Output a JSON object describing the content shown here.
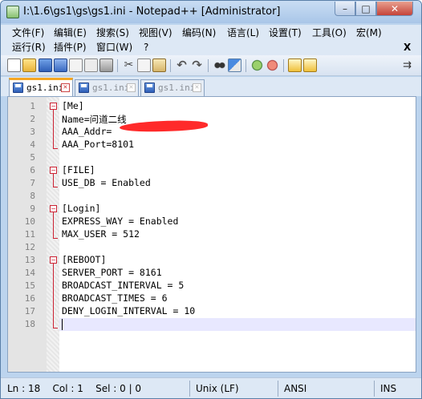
{
  "window": {
    "title": "I:\\1.6\\gs1\\gs\\gs1.ini - Notepad++ [Administrator]",
    "minimize_glyph": "–",
    "maximize_glyph": "□",
    "close_glyph": "✕"
  },
  "menubar": {
    "row1": [
      "文件(F)",
      "编辑(E)",
      "搜索(S)",
      "视图(V)",
      "编码(N)",
      "语言(L)",
      "设置(T)",
      "工具(O)",
      "宏(M)"
    ],
    "row2": [
      "运行(R)",
      "插件(P)",
      "窗口(W)",
      "?"
    ],
    "close_glyph": "X"
  },
  "toolbar": {
    "icons": [
      "new-file-icon",
      "open-file-icon",
      "save-icon",
      "save-all-icon",
      "close-icon",
      "close-all-icon",
      "print-icon",
      "cut-icon",
      "copy-icon",
      "paste-icon",
      "undo-icon",
      "redo-icon",
      "find-icon",
      "replace-icon",
      "zoom-in-icon",
      "zoom-out-icon",
      "sync-v-icon",
      "sync-h-icon",
      "word-wrap-icon"
    ]
  },
  "tabs": [
    {
      "label": "gs1.ini",
      "active": true
    },
    {
      "label": "gs1.ini",
      "active": false
    },
    {
      "label": "gs1.ini",
      "active": false
    }
  ],
  "editor": {
    "lines": [
      {
        "n": "1",
        "text": "[Me]",
        "kind": "section"
      },
      {
        "n": "2",
        "text": "Name=问道二线",
        "kind": "kv"
      },
      {
        "n": "3",
        "text": "AAA_Addr=",
        "kind": "kv"
      },
      {
        "n": "4",
        "text": "AAA_Port=8101",
        "kind": "kv"
      },
      {
        "n": "5",
        "text": "",
        "kind": "blank"
      },
      {
        "n": "6",
        "text": "[FILE]",
        "kind": "section"
      },
      {
        "n": "7",
        "text": "USE_DB = Enabled",
        "kind": "kv"
      },
      {
        "n": "8",
        "text": "",
        "kind": "blank"
      },
      {
        "n": "9",
        "text": "[Login]",
        "kind": "section"
      },
      {
        "n": "10",
        "text": "EXPRESS_WAY = Enabled",
        "kind": "kv"
      },
      {
        "n": "11",
        "text": "MAX_USER = 512",
        "kind": "kv"
      },
      {
        "n": "12",
        "text": "",
        "kind": "blank"
      },
      {
        "n": "13",
        "text": "[REBOOT]",
        "kind": "section"
      },
      {
        "n": "14",
        "text": "SERVER_PORT = 8161",
        "kind": "kv"
      },
      {
        "n": "15",
        "text": "BROADCAST_INTERVAL = 5",
        "kind": "kv"
      },
      {
        "n": "16",
        "text": "BROADCAST_TIMES = 6",
        "kind": "kv"
      },
      {
        "n": "17",
        "text": "DENY_LOGIN_INTERVAL = 10",
        "kind": "kv"
      },
      {
        "n": "18",
        "text": "",
        "kind": "blank"
      }
    ]
  },
  "statusbar": {
    "position": "Ln : 18    Col : 1    Sel : 0 | 0",
    "eol": "Unix (LF)",
    "encoding": "ANSI",
    "mode": "INS"
  }
}
